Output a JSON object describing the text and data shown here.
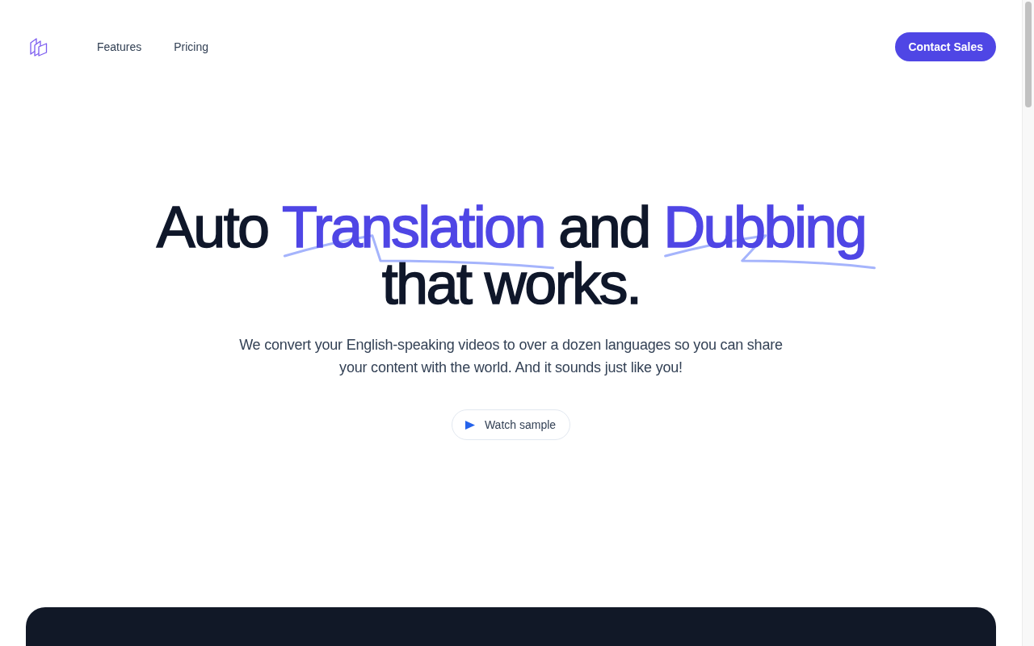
{
  "nav": {
    "links": [
      "Features",
      "Pricing"
    ],
    "cta": "Contact Sales"
  },
  "hero": {
    "headline": {
      "lines": [
        [
          {
            "text": "Auto",
            "highlight": false
          },
          {
            "text": "Translation",
            "highlight": true
          },
          {
            "text": "and",
            "highlight": false
          },
          {
            "text": "Dubbing",
            "highlight": true
          }
        ],
        [
          {
            "text": "that works.",
            "highlight": false
          }
        ]
      ]
    },
    "subtitle": "We convert your English-speaking videos to over a dozen languages so you can share your content with the world. And it sounds just like you!",
    "button": "Watch sample"
  }
}
